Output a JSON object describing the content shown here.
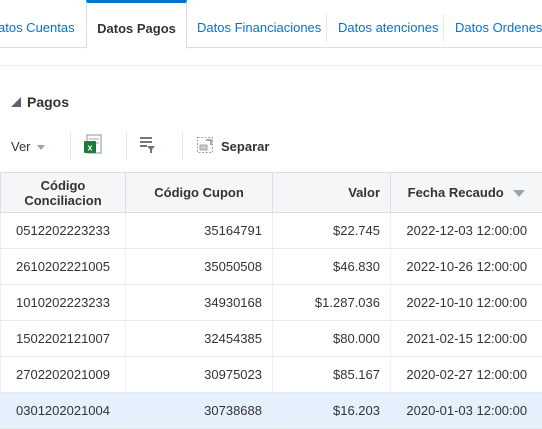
{
  "tabs": [
    {
      "label": "atos Cuentas",
      "active": false
    },
    {
      "label": "Datos Pagos",
      "active": true
    },
    {
      "label": "Datos Financiaciones",
      "active": false
    },
    {
      "label": "Datos atenciones",
      "active": false
    },
    {
      "label": "Datos Ordenes",
      "active": false
    }
  ],
  "section": {
    "title": "Pagos"
  },
  "toolbar": {
    "view_label": "Ver",
    "export_icon": "excel-export-icon",
    "filter_icon": "query-filter-icon",
    "detach_icon": "detach-icon",
    "detach_label": "Separar"
  },
  "table": {
    "headers": [
      "Código Conciliacion",
      "Código Cupon",
      "Valor",
      "Fecha Recaudo"
    ],
    "header_lines": [
      [
        "Código",
        "Conciliacion"
      ]
    ],
    "rows": [
      [
        "0512202223233",
        "35164791",
        "$22.745",
        "2022-12-03 12:00:00"
      ],
      [
        "2610202221005",
        "35050508",
        "$46.830",
        "2022-10-26 12:00:00"
      ],
      [
        "1010202223233",
        "34930168",
        "$1.287.036",
        "2022-10-10 12:00:00"
      ],
      [
        "1502202121007",
        "32454385",
        "$80.000",
        "2021-02-15 12:00:00"
      ],
      [
        "2702202021009",
        "30975023",
        "$85.167",
        "2020-02-27 12:00:00"
      ],
      [
        "0301202021004",
        "30738688",
        "$16.203",
        "2020-01-03 12:00:00"
      ]
    ],
    "selected_row": 5
  },
  "colors": {
    "accent": "#0572ce",
    "selected_row": "#e4f0fb",
    "excel": "#1e7a34"
  }
}
